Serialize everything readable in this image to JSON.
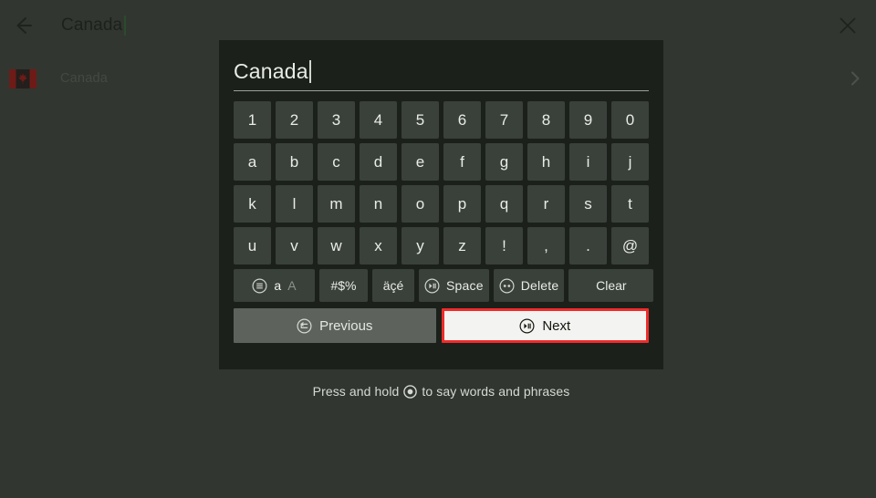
{
  "topbar": {
    "back_icon": "arrow-left-icon",
    "title": "Canada",
    "close_icon": "close-icon"
  },
  "results": {
    "items": [
      {
        "flag_icon": "canada-flag-icon",
        "label": "Canada",
        "chevron_icon": "chevron-right-icon"
      }
    ]
  },
  "keyboard": {
    "input_value": "Canada",
    "rows": [
      [
        "1",
        "2",
        "3",
        "4",
        "5",
        "6",
        "7",
        "8",
        "9",
        "0"
      ],
      [
        "a",
        "b",
        "c",
        "d",
        "e",
        "f",
        "g",
        "h",
        "i",
        "j"
      ],
      [
        "k",
        "l",
        "m",
        "n",
        "o",
        "p",
        "q",
        "r",
        "s",
        "t"
      ],
      [
        "u",
        "v",
        "w",
        "x",
        "y",
        "z",
        "!",
        ",",
        ".",
        "@"
      ]
    ],
    "function_keys": {
      "case_icon": "circled-menu-icon",
      "case_lower": "a",
      "case_upper": "A",
      "symbols": "#$%",
      "accents": "äçé",
      "space_icon": "circled-play-pause-icon",
      "space": "Space",
      "delete_icon": "circled-two-dots-icon",
      "delete": "Delete",
      "clear": "Clear"
    },
    "nav": {
      "previous_icon": "circled-back-arrow-icon",
      "previous": "Previous",
      "next_icon": "circled-play-pause-icon",
      "next": "Next"
    }
  },
  "hint": {
    "text_before": "Press and hold",
    "icon": "circled-dot-icon",
    "text_after": "to say words and phrases"
  },
  "colors": {
    "page_background": "#313630",
    "modal_background": "#1b201b",
    "key_background": "#3a403a",
    "focus_outline": "#ef2b2b",
    "next_button_background": "#f3f3f1",
    "previous_button_background": "#5d635c",
    "flag_red": "#6e1b18"
  }
}
